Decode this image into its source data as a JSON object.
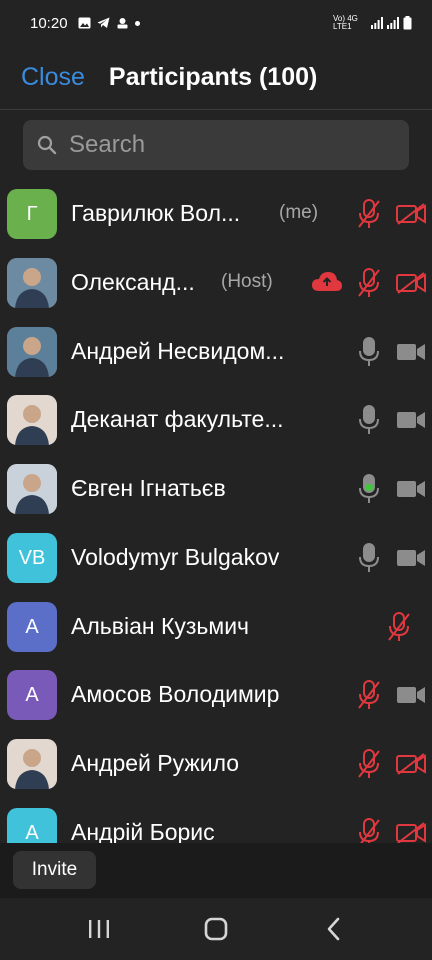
{
  "status": {
    "time": "10:20",
    "network": "Vo) 4G LTE1"
  },
  "header": {
    "close_label": "Close",
    "title": "Participants (100)"
  },
  "search": {
    "placeholder": "Search"
  },
  "participants": [
    {
      "initials": "Г",
      "name": "Гаврилюк Вол...",
      "tag": "(me)",
      "avatar_color": "#6ab04c",
      "cloud": false,
      "mic": "muted",
      "video": "off"
    },
    {
      "initials": "",
      "name": "Олександ...",
      "tag": "(Host)",
      "avatar_color": "#8a6f5a",
      "cloud": true,
      "mic": "muted",
      "video": "off"
    },
    {
      "initials": "",
      "name": "Андрей Несвидом...",
      "tag": "",
      "avatar_color": "#7e8c99",
      "cloud": false,
      "mic": "on",
      "video": "on"
    },
    {
      "initials": "",
      "name": "Деканат факульте...",
      "tag": "",
      "avatar_color": "#4a6d8c",
      "cloud": false,
      "mic": "on",
      "video": "on"
    },
    {
      "initials": "",
      "name": "Євген Ігнатьєв",
      "tag": "",
      "avatar_color": "#d2c7c0",
      "cloud": false,
      "mic": "active",
      "video": "on"
    },
    {
      "initials": "VB",
      "name": "Volodymyr Bulgakov",
      "tag": "",
      "avatar_color": "#40c3da",
      "cloud": false,
      "mic": "on",
      "video": "on"
    },
    {
      "initials": "A",
      "name": "Альвіан Кузьмич",
      "tag": "",
      "avatar_color": "#5b6fc8",
      "cloud": false,
      "mic": "muted",
      "video": "none"
    },
    {
      "initials": "A",
      "name": "Амосов Володимир",
      "tag": "",
      "avatar_color": "#7a5ab8",
      "cloud": false,
      "mic": "muted",
      "video": "on"
    },
    {
      "initials": "",
      "name": "Андрей Ружило",
      "tag": "",
      "avatar_color": "#9aa6ae",
      "cloud": false,
      "mic": "muted",
      "video": "off"
    },
    {
      "initials": "A",
      "name": "Андрій Борис",
      "tag": "",
      "avatar_color": "#40c3da",
      "cloud": false,
      "mic": "muted",
      "video": "off"
    }
  ],
  "footer": {
    "invite_label": "Invite"
  },
  "colors": {
    "accent": "#3a8bdd",
    "muted_red": "#e0383e",
    "icon_gray": "#8c8c8c",
    "active_green": "#44c53f"
  }
}
